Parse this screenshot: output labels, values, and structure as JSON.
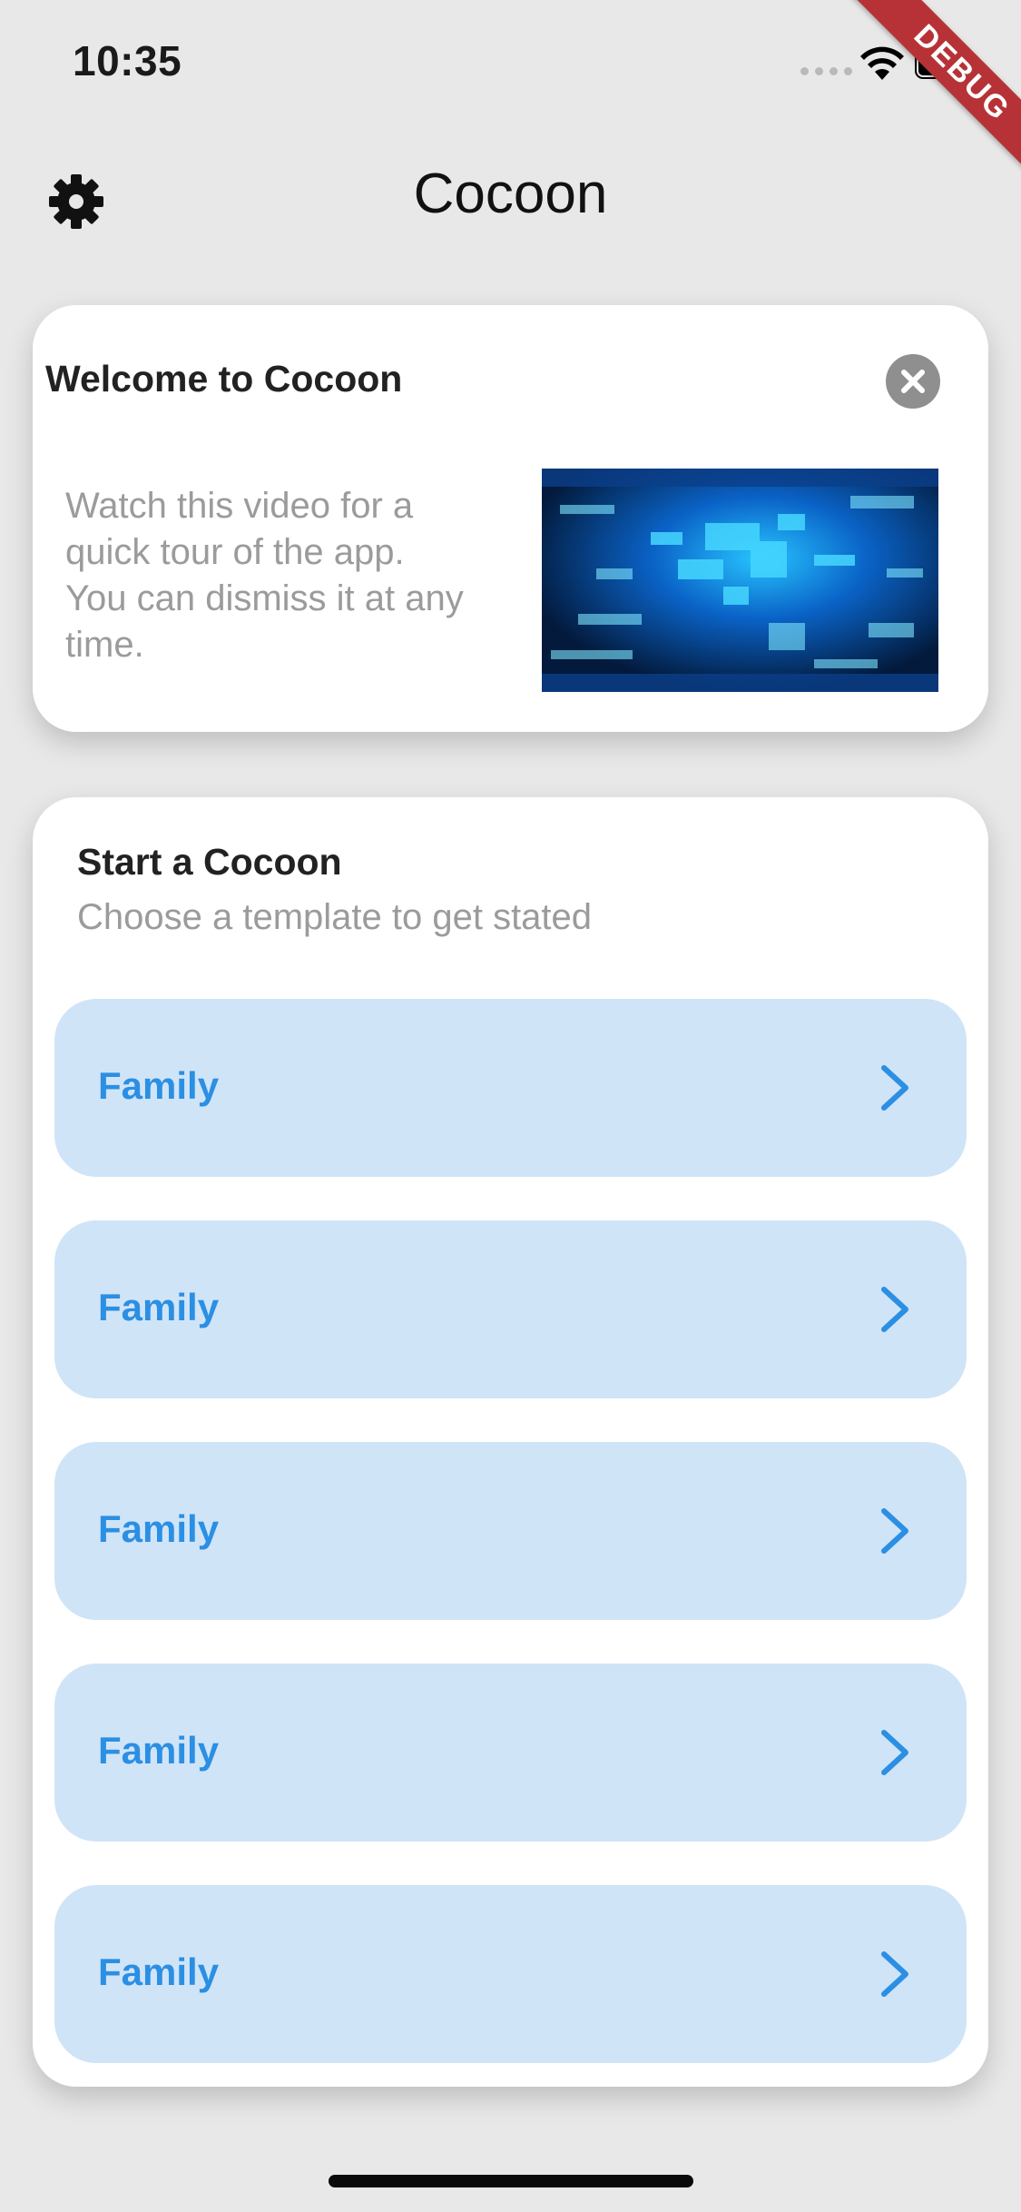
{
  "status_bar": {
    "time": "10:35"
  },
  "debug_banner": "DEBUG",
  "header": {
    "title": "Cocoon",
    "settings_icon": "gear-icon"
  },
  "welcome_card": {
    "title": "Welcome to Cocoon",
    "body": "Watch this video for a quick tour of the app. You can dismiss it at any time.",
    "close_icon": "close-icon"
  },
  "start_card": {
    "title": "Start a Cocoon",
    "subtitle": "Choose a template to get stated",
    "templates": [
      {
        "label": "Family"
      },
      {
        "label": "Family"
      },
      {
        "label": "Family"
      },
      {
        "label": "Family"
      },
      {
        "label": "Family"
      }
    ]
  },
  "colors": {
    "background": "#e8e8e8",
    "card": "#ffffff",
    "template_bg": "#d0e4f7",
    "accent": "#2b8fe3",
    "muted_text": "#9b9b9b",
    "debug": "#b73236"
  }
}
